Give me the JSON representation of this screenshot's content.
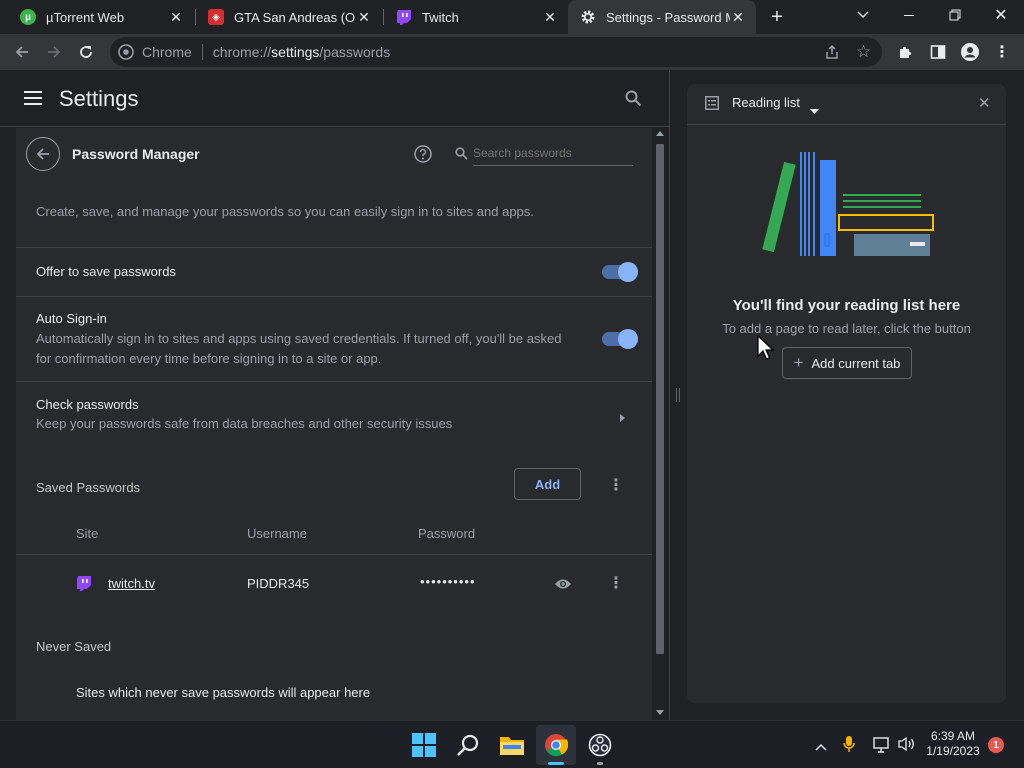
{
  "tabs": [
    {
      "title": "µTorrent Web",
      "favicon": "utorrent-icon",
      "favicon_color": "#39b54a"
    },
    {
      "title": "GTA San Andreas (Original",
      "favicon": "gta-icon",
      "favicon_color": "#d32f2f"
    },
    {
      "title": "Twitch",
      "favicon": "twitch-icon",
      "favicon_color": "#9146ff"
    },
    {
      "title": "Settings - Password Manager",
      "favicon": "gear-icon",
      "favicon_color": "#e8eaed"
    }
  ],
  "omnibox": {
    "site_label": "Chrome",
    "url_scheme": "chrome://",
    "url_host": "settings",
    "url_path": "/passwords"
  },
  "settings": {
    "title": "Settings",
    "page_title": "Password Manager",
    "search_placeholder": "Search passwords",
    "description": "Create, save, and manage your passwords so you can easily sign in to sites and apps.",
    "offer_save": {
      "label": "Offer to save passwords",
      "enabled": true
    },
    "auto_signin": {
      "label": "Auto Sign-in",
      "description": "Automatically sign in to sites and apps using saved credentials. If turned off, you'll be asked for confirmation every time before signing in to a site or app.",
      "enabled": true
    },
    "check_passwords": {
      "label": "Check passwords",
      "description": "Keep your passwords safe from data breaches and other security issues"
    },
    "saved_passwords": {
      "heading": "Saved Passwords",
      "add_label": "Add",
      "columns": [
        "Site",
        "Username",
        "Password"
      ],
      "rows": [
        {
          "site": "twitch.tv",
          "username": "PIDDR345",
          "password": "••••••••••"
        }
      ]
    },
    "never_saved": {
      "heading": "Never Saved",
      "empty_text": "Sites which never save passwords will appear here"
    }
  },
  "reading_list": {
    "title": "Reading list",
    "empty_title": "You'll find your reading list here",
    "empty_subtitle": "To add a page to read later, click the button",
    "add_label": "Add current tab"
  },
  "taskbar": {
    "time": "6:39 AM",
    "date": "1/19/2023",
    "notification_count": "1"
  },
  "colors": {
    "accent": "#8ab4f8",
    "toggle_track": "#4d6fa8",
    "panel": "#292a2d",
    "background": "#202124"
  }
}
